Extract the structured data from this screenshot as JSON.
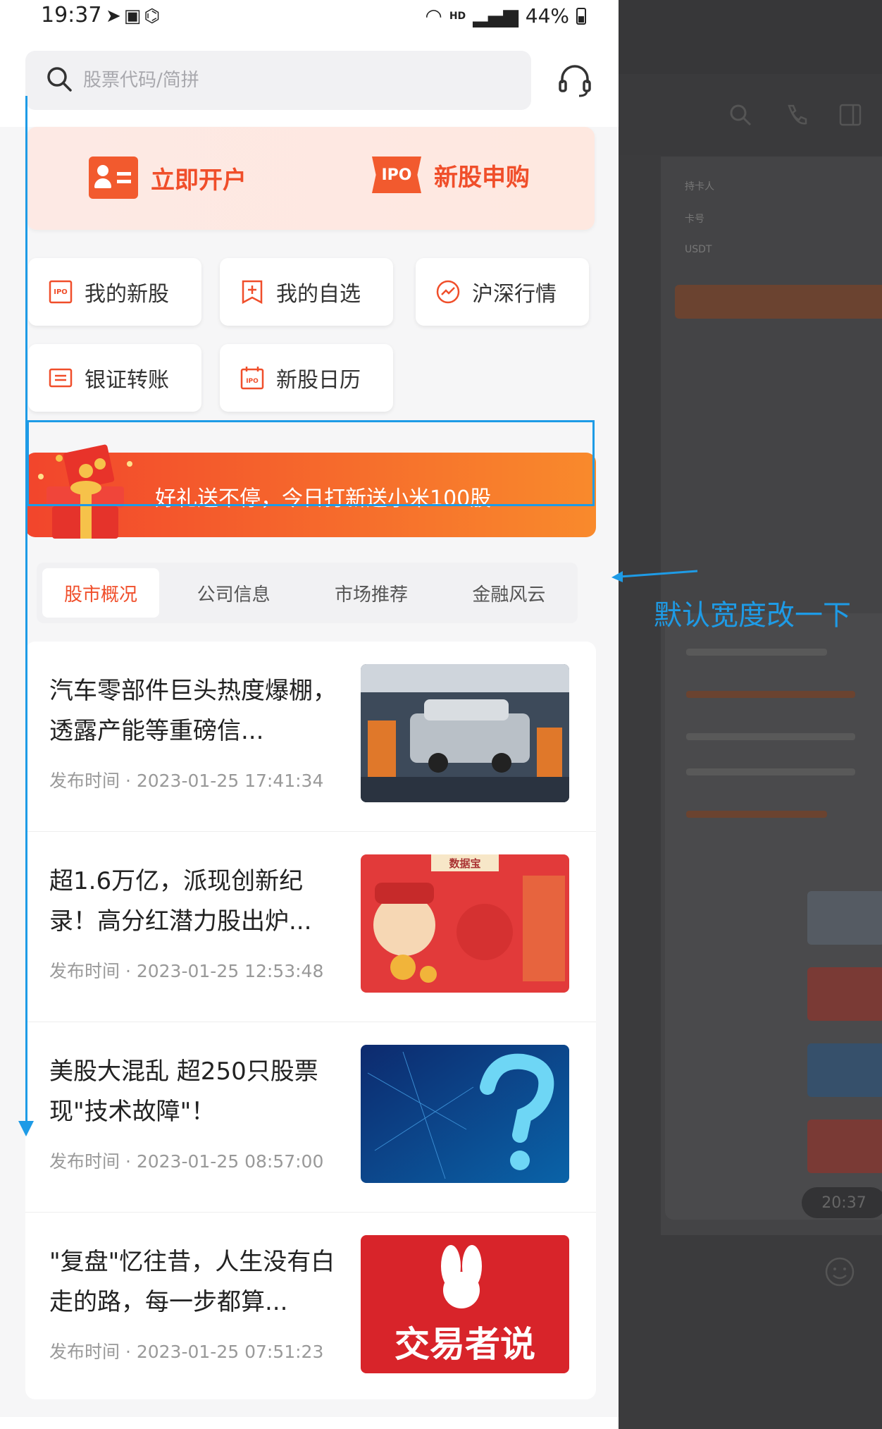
{
  "status_bar": {
    "time": "19:37",
    "hd": "HD",
    "battery": "44%"
  },
  "search": {
    "placeholder": "股票代码/简拼"
  },
  "banner": {
    "open_account": "立即开户",
    "ipo_badge": "IPO",
    "ipo_subscribe": "新股申购"
  },
  "quick_links": [
    {
      "label": "我的新股",
      "icon": "ipo-certificate-icon"
    },
    {
      "label": "我的自选",
      "icon": "add-favorite-icon"
    },
    {
      "label": "沪深行情",
      "icon": "market-trend-icon"
    },
    {
      "label": "银证转账",
      "icon": "transfer-icon"
    },
    {
      "label": "新股日历",
      "icon": "ipo-calendar-icon"
    }
  ],
  "promo": {
    "text": "好礼送不停，今日打新送小米100股"
  },
  "tabs": [
    {
      "label": "股市概况",
      "active": true
    },
    {
      "label": "公司信息",
      "active": false
    },
    {
      "label": "市场推荐",
      "active": false
    },
    {
      "label": "金融风云",
      "active": false
    }
  ],
  "news": [
    {
      "title": "汽车零部件巨头热度爆棚，透露产能等重磅信...",
      "time": "发布时间 · 2023-01-25 17:41:34",
      "thumb": "car-factory"
    },
    {
      "title": "超1.6万亿，派现创新纪录！高分红潜力股出炉...",
      "time": "发布时间 · 2023-01-25 12:53:48",
      "thumb": "god-of-wealth",
      "thumb_caption": "数据宝"
    },
    {
      "title": "美股大混乱 超250只股票现\"技术故障\"！",
      "time": "发布时间 · 2023-01-25 08:57:00",
      "thumb": "question-mark"
    },
    {
      "title": "\"复盘\"忆往昔，人生没有白走的路，每一步都算...",
      "time": "发布时间 · 2023-01-25 07:51:23",
      "thumb": "trader-says",
      "thumb_caption": "交易者说"
    }
  ],
  "annotation": {
    "text": "默认宽度改一下"
  },
  "overlay": {
    "rows": [
      "持卡人",
      "卡号",
      "USDT"
    ],
    "time_pill": "20:37"
  },
  "colors": {
    "accent": "#f04e2a",
    "annotation": "#1e9be6",
    "overlay": "#3b3b3d"
  }
}
